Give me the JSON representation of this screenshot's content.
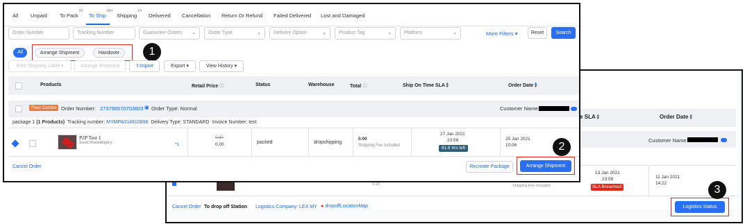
{
  "back": {
    "columns": {
      "sla": "me SLA",
      "order_date": "Order Date"
    },
    "customer_label": "Customer Name:",
    "row": {
      "sla_date": "13 Jan 2021",
      "sla_time": "23:59",
      "sla_badge": "SLA Breached!",
      "order_date": "11 Jan 2021",
      "order_time": "14:22",
      "partial_value": "0.00",
      "partial_fee": "Shipping Fee Included"
    },
    "footer": {
      "cancel_order": "Cancel Order",
      "status": "To drop off Station",
      "logistics_company": "Logistics Company: LEX MY",
      "dropoff_map": "dropoffLocationMap",
      "logistics_status": "Logistics Status"
    },
    "badge_number": "3"
  },
  "front": {
    "tabs": [
      {
        "label": "All"
      },
      {
        "label": "Unpaid"
      },
      {
        "label": "To Pack",
        "count": "20"
      },
      {
        "label": "To Ship",
        "count": "99+"
      },
      {
        "label": "Shipping",
        "count": "10"
      },
      {
        "label": "Delivered"
      },
      {
        "label": "Cancellation"
      },
      {
        "label": "Return Or Refund"
      },
      {
        "label": "Failed Delivered"
      },
      {
        "label": "Lost and Damaged"
      }
    ],
    "filters": {
      "order_number": "Order Number",
      "tracking_number": "Tracking Number",
      "guarantee_orders": "Guarantee Orders",
      "order_type": "Order Type",
      "delivery_option": "Delivery Option",
      "product_tag": "Product Tag",
      "platform": "Platform",
      "more_filters": "More Filters",
      "reset": "Reset",
      "search": "Search"
    },
    "subtabs": {
      "all": "All",
      "arrange_shipment": "Arrange Shipment",
      "handover": "Handover"
    },
    "badge_number_1": "1",
    "badge_number_2": "2",
    "actions": {
      "print_shipping_label": "Print Shipping Label",
      "arrange_shipment": "Arrange Shipment",
      "import": "Import",
      "export": "Export",
      "view_history": "View History"
    },
    "table": {
      "headers": {
        "products": "Products",
        "retail_price": "Retail Price",
        "status": "Status",
        "warehouse": "Warehouse",
        "total": "Total",
        "ship_on_time_sla": "Ship On Time SLA",
        "order_date": "Order Date"
      },
      "combo_tag": "Flexi Combo",
      "order_number_label": "Order Number:",
      "order_number": "273796570703803",
      "order_type": "Order Type:  Normal",
      "customer_label": "Customer Name:",
      "package": {
        "label": "package 1",
        "count": "(1 Products)",
        "tracking_label": "Tracking number:",
        "tracking_number": "MYMPA014910898",
        "delivery_type": "Delivery Type: STANDARD",
        "invoice": "Invoice Number: test"
      },
      "row": {
        "product_name": "P2P Test 1",
        "product_variant": "Scent:Warm&Spicy",
        "qty": "*1",
        "price_old": "0.00",
        "price_new": "0.00",
        "status": "packed",
        "warehouse": "dropshipping",
        "total": "0.00",
        "total_note": "Shipping Fee Included",
        "sla_date": "27 Jan 2021",
        "sla_time": "23:59",
        "sla_badge": "61.6 hrs left",
        "order_date": "25 Jan 2021",
        "order_time": "10:06"
      }
    },
    "footer": {
      "cancel_order": "Cancel Order",
      "recreate_package": "Recreate Package",
      "arrange_shipment": "Arrange Shipment"
    }
  },
  "colors": {
    "accent": "#2a6ff0",
    "callout": "#e0251c",
    "combo_tag": "#f07a3a",
    "sla_ok": "#2f5f7a",
    "sla_breached": "#e0251c"
  }
}
